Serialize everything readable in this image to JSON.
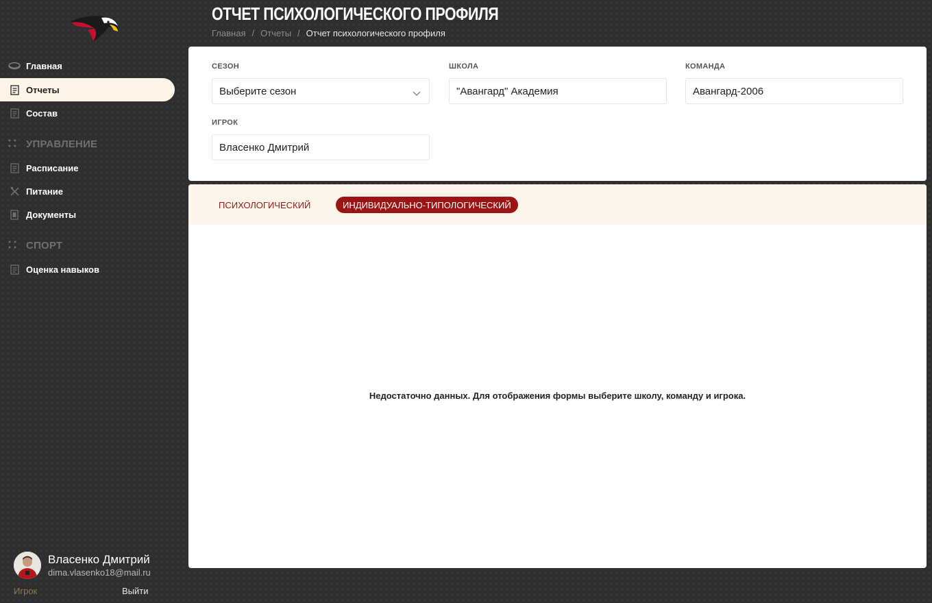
{
  "header": {
    "title": "ОТЧЕТ ПСИХОЛОГИЧЕСКОГО ПРОФИЛЯ",
    "breadcrumb": [
      "Главная",
      "Отчеты",
      "Отчет психологического профиля"
    ],
    "breadcrumb_separator": "/"
  },
  "sidebar": {
    "logo": "avangard-hawk-logo",
    "items": [
      {
        "label": "Главная",
        "icon": "puck-icon",
        "active": false
      },
      {
        "label": "Отчеты",
        "icon": "report-icon",
        "active": true
      },
      {
        "label": "Состав",
        "icon": "document-icon",
        "active": false
      }
    ],
    "sections": [
      {
        "title": "УПРАВЛЕНИЕ",
        "items": [
          {
            "label": "Расписание",
            "icon": "document-icon"
          },
          {
            "label": "Питание",
            "icon": "utensils-icon"
          },
          {
            "label": "Документы",
            "icon": "file-icon"
          }
        ]
      },
      {
        "title": "СПОРТ",
        "items": [
          {
            "label": "Оценка навыков",
            "icon": "document-icon"
          }
        ]
      }
    ]
  },
  "user": {
    "name": "Власенко Дмитрий",
    "email": "dima.vlasenko18@mail.ru",
    "role": "Игрок",
    "logout_label": "Выйти"
  },
  "filters": {
    "season": {
      "label": "СЕЗОН",
      "value": "Выберите сезон"
    },
    "school": {
      "label": "ШКОЛА",
      "value": "\"Авангард\" Академия"
    },
    "team": {
      "label": "КОМАНДА",
      "value": "Авангард-2006"
    },
    "player": {
      "label": "ИГРОК",
      "value": "Власенко Дмитрий"
    }
  },
  "tabs": [
    {
      "label": "ПСИХОЛОГИЧЕСКИЙ",
      "active": false
    },
    {
      "label": "ИНДИВИДУАЛЬНО-ТИПОЛОГИЧЕСКИЙ",
      "active": true
    }
  ],
  "empty_message": "Недостаточно данных. Для отображения формы выберите школу, команду и игрока.",
  "colors": {
    "accent": "#9c1313",
    "active_nav_bg": "#fdf4e6",
    "tabs_bg": "#fdf5ea",
    "sidebar_bg": "#2f2f2f"
  }
}
